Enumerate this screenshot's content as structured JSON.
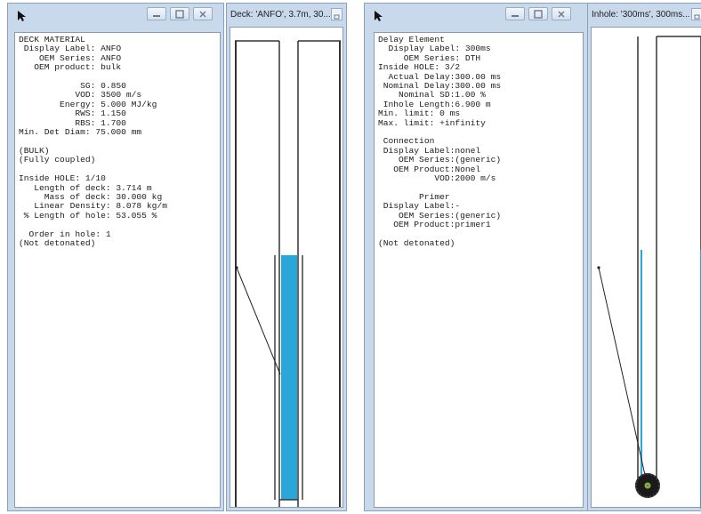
{
  "left_info": {
    "lines": [
      "DECK MATERIAL",
      " Display Label: ANFO",
      "    OEM Series: ANFO",
      "   OEM product: bulk",
      "",
      "            SG: 0.850",
      "           VOD: 3500 m/s",
      "        Energy: 5.000 MJ/kg",
      "           RWS: 1.150",
      "           RBS: 1.700",
      "Min. Det Diam: 75.000 mm",
      "",
      "(BULK)",
      "(Fully coupled)",
      "",
      "Inside HOLE: 1/10",
      "   Length of deck: 3.714 m",
      "     Mass of deck: 30.000 kg",
      "   Linear Density: 8.078 kg/m",
      " % Length of hole: 53.055 %",
      "",
      "  Order in hole: 1",
      "(Not detonated)"
    ]
  },
  "deck_window": {
    "title": "Deck: 'ANFO', 3.7m, 30..."
  },
  "right_info": {
    "lines": [
      "Delay Element",
      "  Display Label: 300ms",
      "     OEM Series: DTH",
      "Inside HOLE: 3/2",
      "  Actual Delay:300.00 ms",
      " Nominal Delay:300.00 ms",
      "    Nominal SD:1.00 %",
      " Inhole Length:6.900 m",
      "Min. limit: 0 ms",
      "Max. limit: +infinity",
      "",
      " Connection",
      " Display Label:nonel",
      "    OEM Series:(generic)",
      "   OEM Product:Nonel",
      "           VOD:2000 m/s",
      "",
      "        Primer",
      " Display Label:-",
      "    OEM Series:(generic)",
      "   OEM Product:primer1",
      "",
      "(Not detonated)"
    ]
  },
  "inhole_window": {
    "title": "Inhole: '300ms', 300ms..."
  },
  "colors": {
    "explosive_fill": "#2aa6d8",
    "frame_blue": "#c9d9ec",
    "detonator": "#1a1a1a"
  }
}
